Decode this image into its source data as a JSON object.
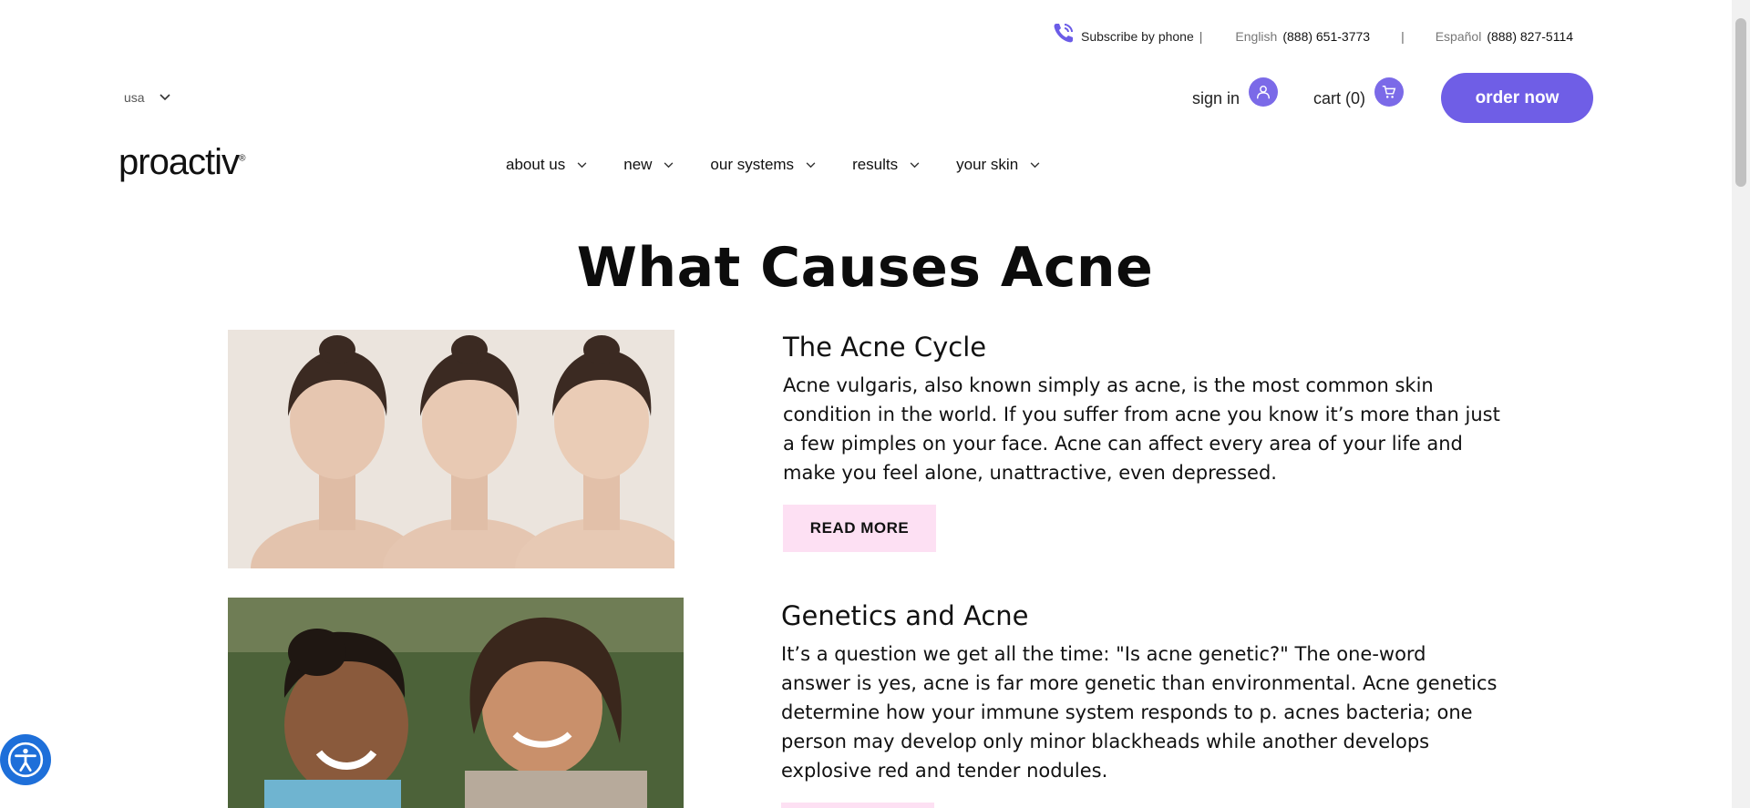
{
  "utility": {
    "subscribe_label": "Subscribe by phone",
    "separator": "|",
    "english_label": "English",
    "english_phone": "(888) 651-3773",
    "spanish_label": "Español",
    "spanish_phone": "(888) 827-5114"
  },
  "header": {
    "region": "usa",
    "sign_in": "sign in",
    "cart": "cart (0)",
    "order_now": "order now",
    "logo": "proactiv",
    "logo_mark": "®"
  },
  "nav": {
    "items": [
      {
        "label": "about us"
      },
      {
        "label": "new"
      },
      {
        "label": "our systems"
      },
      {
        "label": "results"
      },
      {
        "label": "your skin"
      }
    ]
  },
  "page": {
    "title": "What Causes Acne"
  },
  "articles": [
    {
      "heading": "The Acne Cycle",
      "body": "Acne vulgaris, also known simply as acne, is the most common skin condition in the world. If you suffer from acne you know it’s more than just a few pimples on your face. Acne can affect every area of your life and make you feel alone, unattractive, even depressed.",
      "cta": "READ MORE"
    },
    {
      "heading": "Genetics and Acne",
      "body": "It’s a question we get all the time: \"Is acne genetic?\" The one-word answer is yes, acne is far more genetic than environmental. Acne genetics determine how your immune system responds to p. acnes bacteria; one person may develop only minor blackheads while another develops explosive red and tender nodules."
    }
  ],
  "colors": {
    "accent": "#6f5ee6",
    "readmore_bg": "#fde0f3",
    "accessibility": "#1e6fd9"
  },
  "icons": [
    "phone-icon",
    "chevron-down-icon",
    "user-icon",
    "cart-icon",
    "accessibility-icon"
  ]
}
